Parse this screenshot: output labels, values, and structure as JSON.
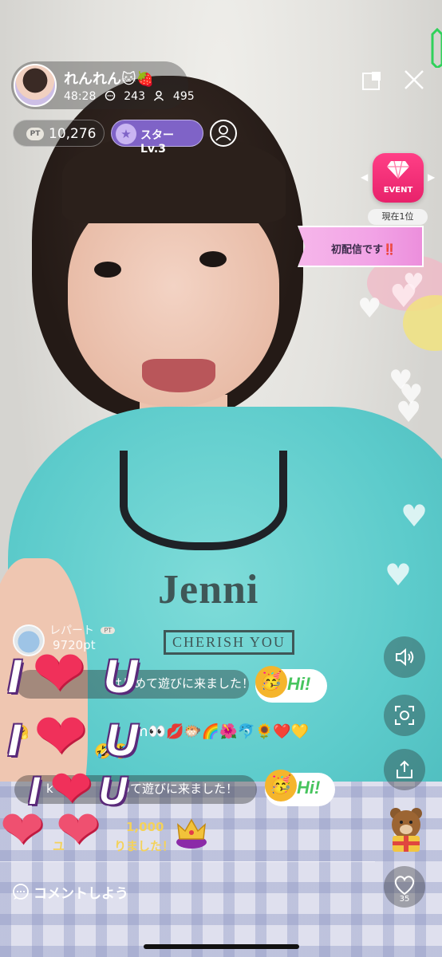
{
  "host": {
    "name": "れんれん",
    "name_emojis": "🐱🍓",
    "elapsed": "48:28",
    "comments": "243",
    "viewers": "495"
  },
  "points": {
    "badge": "PT",
    "value": "10,276"
  },
  "star": {
    "label": "スター Lv.3"
  },
  "event": {
    "label": "EVENT",
    "rank": "現在1位",
    "title_banner": "初配信です‼️"
  },
  "comments": {
    "reporter_name": "レパート",
    "reporter_badge": "PT",
    "reporter_points": "9720pt",
    "visit_line_1": "はじめて遊びに来ました！",
    "emoji_line": "m👀💋🐡🌈🌺🐬🌻❤️💛",
    "emoji_line_2": "🤣🤣",
    "visit_line_2": "めて遊びに来ました！",
    "visit_prefix_2": "k",
    "gift_points": "1,000",
    "gift_line": "りました！",
    "gift_prefix": "ユ",
    "hi_sticker": "Hi!",
    "hi_emoji": "🥳"
  },
  "overlay": {
    "i_letter": "I",
    "u_letter": "U",
    "heart": "❤"
  },
  "controls": {
    "like_count": "35"
  },
  "comment_input": {
    "placeholder": "コメントしよう"
  },
  "colors": {
    "event_pink": "#e8226b",
    "star_purple": "#7f63c7",
    "hi_green": "#47c45e",
    "gift_gold": "#f4d25a"
  },
  "icons": {
    "minimize": "minimize-icon",
    "close": "close-icon",
    "volume": "volume-icon",
    "screenshot": "screenshot-icon",
    "share": "share-icon",
    "gift": "gift-bear-icon",
    "like": "heart-like-icon",
    "profile": "user-profile-icon",
    "comment": "comment-bubble-icon",
    "crown": "crown-icon"
  }
}
